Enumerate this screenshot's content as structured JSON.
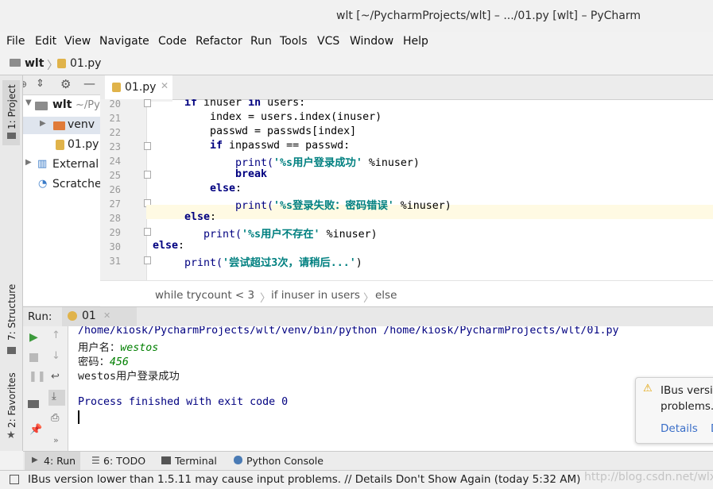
{
  "window": {
    "title": "wlt [~/PycharmProjects/wlt] – .../01.py [wlt] – PyCharm"
  },
  "menu": [
    "File",
    "Edit",
    "View",
    "Navigate",
    "Code",
    "Refactor",
    "Run",
    "Tools",
    "VCS",
    "Window",
    "Help"
  ],
  "navbar": {
    "project": "wlt",
    "file": "01.py"
  },
  "left_tabs": {
    "project": "1: Project",
    "structure": "7: Structure",
    "favorites": "2: Favorites"
  },
  "tree": {
    "root": "wlt",
    "root_path": "~/Py",
    "venv": "venv",
    "file": "01.py",
    "external": "External",
    "scratches": "Scratche"
  },
  "editor": {
    "tab": "01.py",
    "line_numbers": [
      "20",
      "21",
      "22",
      "23",
      "24",
      "25",
      "26",
      "27",
      "28",
      "29",
      "30",
      "31"
    ],
    "breadcrumbs": [
      "while trycount < 3",
      "if inuser in users",
      "else"
    ]
  },
  "code": {
    "l20a": "if",
    "l20b": " inuser ",
    "l20c": "in",
    "l20d": " users:",
    "l21": "index = users.index(inuser)",
    "l22": "passwd = passwds[index]",
    "l23a": "if",
    "l23b": " inpasswd == passwd:",
    "l24a": "print(",
    "l24b": "'%s用户登录成功'",
    "l24c": " %inuser)",
    "l25": "break",
    "l26": "else",
    "l26b": ":",
    "l27a": "print(",
    "l27b": "'%s登录失败：密码错误'",
    "l27c": " %inuser)",
    "l28a": "else",
    "l28b": ":",
    "l29a": "print(",
    "l29b": "'%s用户不存在'",
    "l29c": " %inuser)",
    "l30a": "else",
    "l30b": ":",
    "l31a": "print(",
    "l31b": "'尝试超过3次，请稍后...'",
    "l31c": ")"
  },
  "run": {
    "label": "Run:",
    "tab": "01",
    "cmd": "/home/kiosk/PycharmProjects/wlt/venv/bin/python /home/kiosk/PycharmProjects/wlt/01.py",
    "prompt_user": "用户名：",
    "user_input": "westos",
    "prompt_pass": "密码：",
    "pass_input": "456",
    "result": "westos用户登录成功",
    "exit": "Process finished with exit code 0"
  },
  "notification": {
    "title": "IBus versio",
    "text": "problems.",
    "details": "Details",
    "more": "D"
  },
  "bottom_tabs": {
    "run": "4: Run",
    "todo": "6: TODO",
    "terminal": "Terminal",
    "console": "Python Console"
  },
  "status": {
    "text": "IBus version lower than 1.5.11 may cause input problems. // Details Don't Show Again (today 5:32 AM)",
    "watermark": "http://blog.csdn.net/wlxiyou"
  },
  "colors": {
    "keyword": "#000080",
    "string": "#008080",
    "console_blue": "#000080",
    "input_green": "#007f00",
    "caret_line": "#fffae3"
  }
}
